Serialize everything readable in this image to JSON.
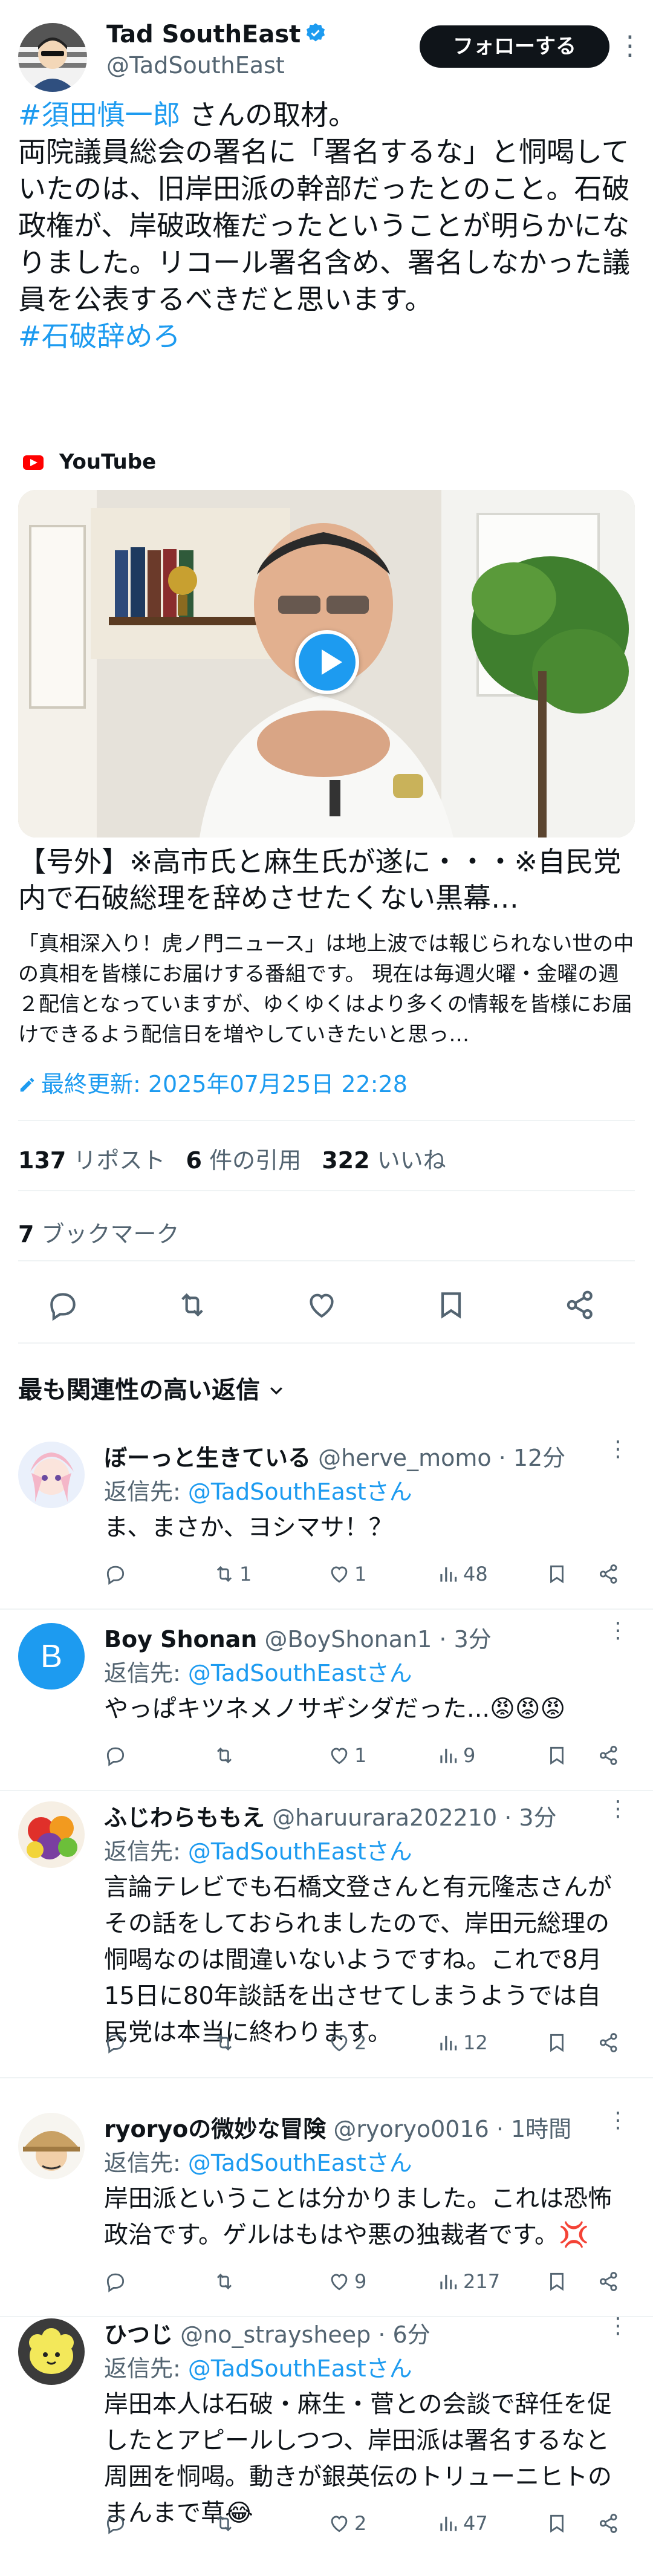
{
  "author": {
    "name": "Tad SouthEast",
    "handle": "@TadSouthEast",
    "follow_label": "フォローする"
  },
  "tweet": {
    "hashtag_top": "#須田慎一郎",
    "line1_rest": " さんの取材。",
    "body": "両院議員総会の署名に「署名するな」と恫喝していたのは、旧岸田派の幹部だったとのこと。石破政権が、岸破政権だったということが明らかになりました。リコール署名含め、署名しなかった議員を公表するべきだと思います。",
    "hashtag_bottom": "#石破辞めろ"
  },
  "card": {
    "source": "YouTube",
    "title": "【号外】※高市氏と麻生氏が遂に・・・※自民党内で石破総理を辞めさせたくない黒幕…",
    "description": "「真相深入り！虎ノ門ニュース」は地上波では報じられない世の中の真相を皆様にお届けする番組です。 現在は毎週火曜・金曜の週２配信となっていますが、ゆくゆくはより多くの情報を皆様にお届けできるよう配信日を増やしていきたいと思っ…",
    "last_updated": "最終更新: 2025年07月25日 22:28"
  },
  "stats": {
    "reposts_count": "137",
    "reposts_label": "リポスト",
    "quotes_count": "6",
    "quotes_label": "件の引用",
    "likes_count": "322",
    "likes_label": "いいね",
    "bookmarks_count": "7",
    "bookmarks_label": "ブックマーク"
  },
  "sort_label": "最も関連性の高い返信",
  "reply_to_prefix": "返信先: ",
  "reply_to_target": "@TadSouthEastさん",
  "replies": [
    {
      "name": "ぼーっと生きている",
      "meta": "@herve_momo · 12分",
      "text": "ま、まさか、ヨシマサ！？",
      "replies": "",
      "reposts": "1",
      "likes": "1",
      "views": "48"
    },
    {
      "name": "Boy Shonan",
      "meta": "@BoyShonan1 · 3分",
      "avatar_letter": "B",
      "text": "やっぱキツネメノサギシダだった...😡😡😡",
      "replies": "",
      "reposts": "",
      "likes": "1",
      "views": "9"
    },
    {
      "name": "ふじわらももえ",
      "meta": "@haruurara202210 · 3分",
      "text": "言論テレビでも石橋文登さんと有元隆志さんがその話をしておられましたので、岸田元総理の恫喝なのは間違いないようですね。これで8月15日に80年談話を出させてしまうようでは自民党は本当に終わります。",
      "replies": "",
      "reposts": "",
      "likes": "2",
      "views": "12"
    },
    {
      "name": "ryoryoの微妙な冒険",
      "meta": "@ryoryo0016 · 1時間",
      "text": "岸田派ということは分かりました。これは恐怖政治です。ゲルはもはや悪の独裁者です。💢",
      "replies": "",
      "reposts": "",
      "likes": "9",
      "views": "217"
    },
    {
      "name": "ひつじ",
      "meta": "@no_straysheep · 6分",
      "text": "岸田本人は石破・麻生・菅との会談で辞任を促したとアピールしつつ、岸田派は署名するなと周囲を恫喝。動きが銀英伝のトリューニヒトのまんまで草😂",
      "replies": "",
      "reposts": "",
      "likes": "2",
      "views": "47"
    }
  ],
  "colors": {
    "accent": "#1d9bf0",
    "text": "#0f1419",
    "muted": "#536471",
    "divider": "#eff3f4",
    "follow_bg": "#0f1419"
  }
}
